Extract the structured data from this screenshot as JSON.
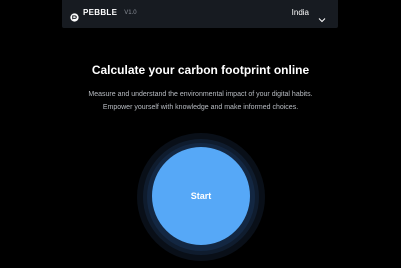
{
  "header": {
    "brand": "PEBBLE",
    "version": "V1.0",
    "logo_icon": "pebble-logo-icon",
    "country": "India",
    "country_icon": "chevron-down-icon"
  },
  "hero": {
    "title": "Calculate your carbon footprint online",
    "description": "Measure and understand the environmental impact of your digital habits. Empower yourself with knowledge and make informed choices.",
    "start_label": "Start"
  },
  "colors": {
    "background": "#000000",
    "header_bg": "#171b21",
    "accent": "#56a8f7",
    "muted_text": "#b9bdc3"
  }
}
